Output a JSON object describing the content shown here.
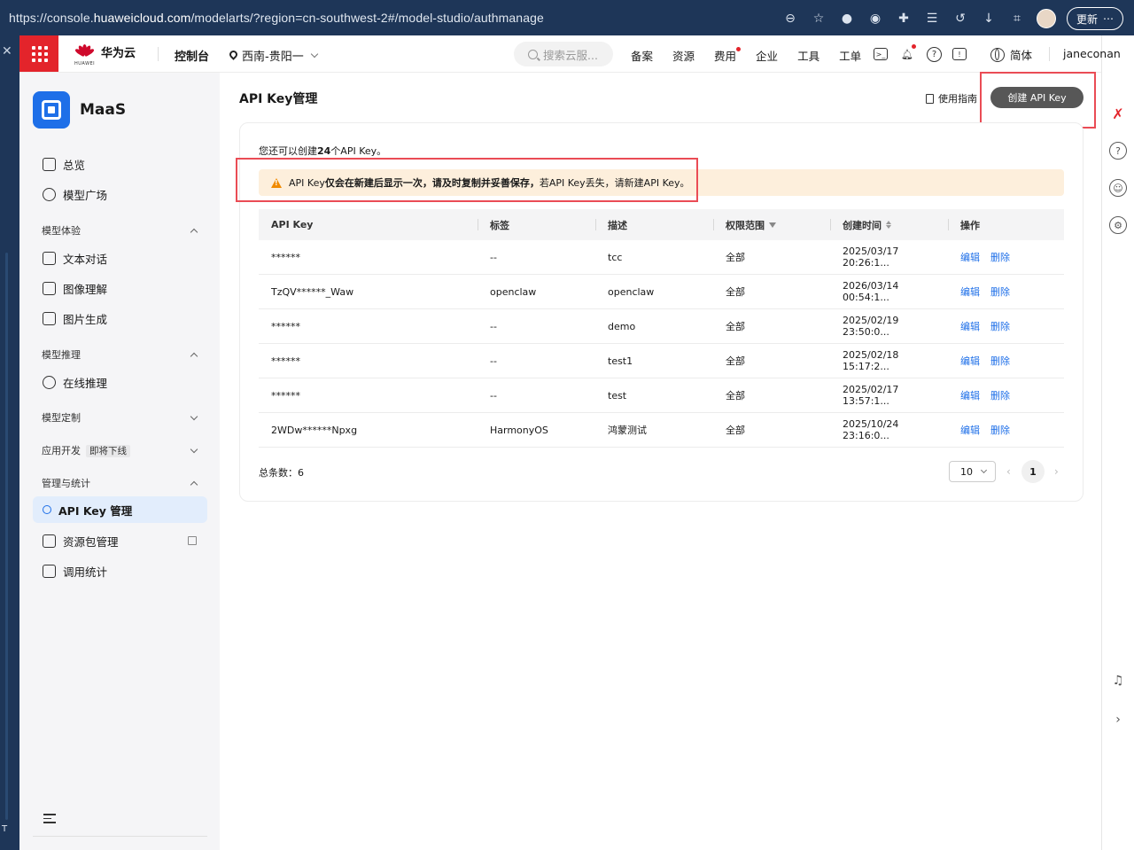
{
  "browser": {
    "url_prefix": "https://console.",
    "url_host": "huaweicloud.com",
    "url_path": "/modelarts/?region=cn-southwest-2#/model-studio/authmanage",
    "update_label": "更新"
  },
  "topnav": {
    "brand": "华为云",
    "brand_sub": "HUAWEI",
    "console": "控制台",
    "region": "西南-贵阳一",
    "search_placeholder": "搜索云服...",
    "links": [
      "备案",
      "资源",
      "费用",
      "企业",
      "工具",
      "工单"
    ],
    "lang": "简体",
    "username": "janeconan"
  },
  "sidebar": {
    "title": "MaaS",
    "top_items": [
      {
        "label": "总览"
      },
      {
        "label": "模型广场"
      }
    ],
    "groups": {
      "experience": "模型体验",
      "inference": "模型推理",
      "custom": "模型定制",
      "appdev": "应用开发",
      "appdev_tag": "即将下线",
      "manage": "管理与统计"
    },
    "experience_items": [
      "文本对话",
      "图像理解",
      "图片生成"
    ],
    "inference_items": [
      "在线推理"
    ],
    "manage_items": [
      "API Key 管理",
      "资源包管理",
      "调用统计"
    ]
  },
  "main": {
    "title": "API Key管理",
    "guide": "使用指南",
    "create_button": "创建 API Key",
    "quota_prefix": "您还可以创建",
    "quota_count": "24",
    "quota_suffix": "个API Key。",
    "warning_lead": "API Key",
    "warning_bold": "仅会在新建后显示一次，请及时复制并妥善保存，",
    "warning_tail": "若API Key丢失，请新建API Key。",
    "columns": [
      "API Key",
      "标签",
      "描述",
      "权限范围",
      "创建时间",
      "操作"
    ],
    "rows": [
      {
        "key": "******",
        "tag": "--",
        "desc": "tcc",
        "scope": "全部",
        "time": "2025/03/17 20:26:1..."
      },
      {
        "key": "TzQV******_Waw",
        "tag": "openclaw",
        "desc": "openclaw",
        "scope": "全部",
        "time": "2026/03/14 00:54:1..."
      },
      {
        "key": "******",
        "tag": "--",
        "desc": "demo",
        "scope": "全部",
        "time": "2025/02/19 23:50:0..."
      },
      {
        "key": "******",
        "tag": "--",
        "desc": "test1",
        "scope": "全部",
        "time": "2025/02/18 15:17:2..."
      },
      {
        "key": "******",
        "tag": "--",
        "desc": "test",
        "scope": "全部",
        "time": "2025/02/17 13:57:1..."
      },
      {
        "key": "2WDw******Npxg",
        "tag": "HarmonyOS",
        "desc": "鸿蒙测试",
        "scope": "全部",
        "time": "2025/10/24 23:16:0..."
      }
    ],
    "edit_label": "编辑",
    "delete_label": "删除",
    "total_label": "总条数：",
    "total": "6",
    "page_size": "10",
    "current_page": "1"
  }
}
